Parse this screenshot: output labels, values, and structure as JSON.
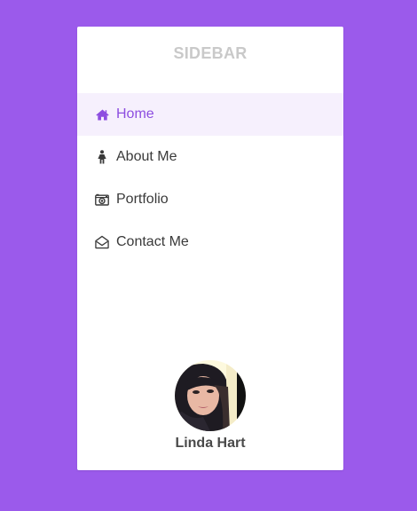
{
  "sidebar": {
    "title": "SIDEBAR",
    "items": [
      {
        "label": "Home",
        "icon": "home-icon",
        "active": true
      },
      {
        "label": "About Me",
        "icon": "person-icon",
        "active": false
      },
      {
        "label": "Portfolio",
        "icon": "camera-icon",
        "active": false
      },
      {
        "label": "Contact Me",
        "icon": "envelope-open-icon",
        "active": false
      }
    ]
  },
  "profile": {
    "name": "Linda Hart"
  },
  "colors": {
    "background": "#9b5aeb",
    "accent": "#8d4ee0",
    "active_bg": "#f6f0fd",
    "title": "#c9c9c9",
    "text": "#3a3a3a"
  }
}
